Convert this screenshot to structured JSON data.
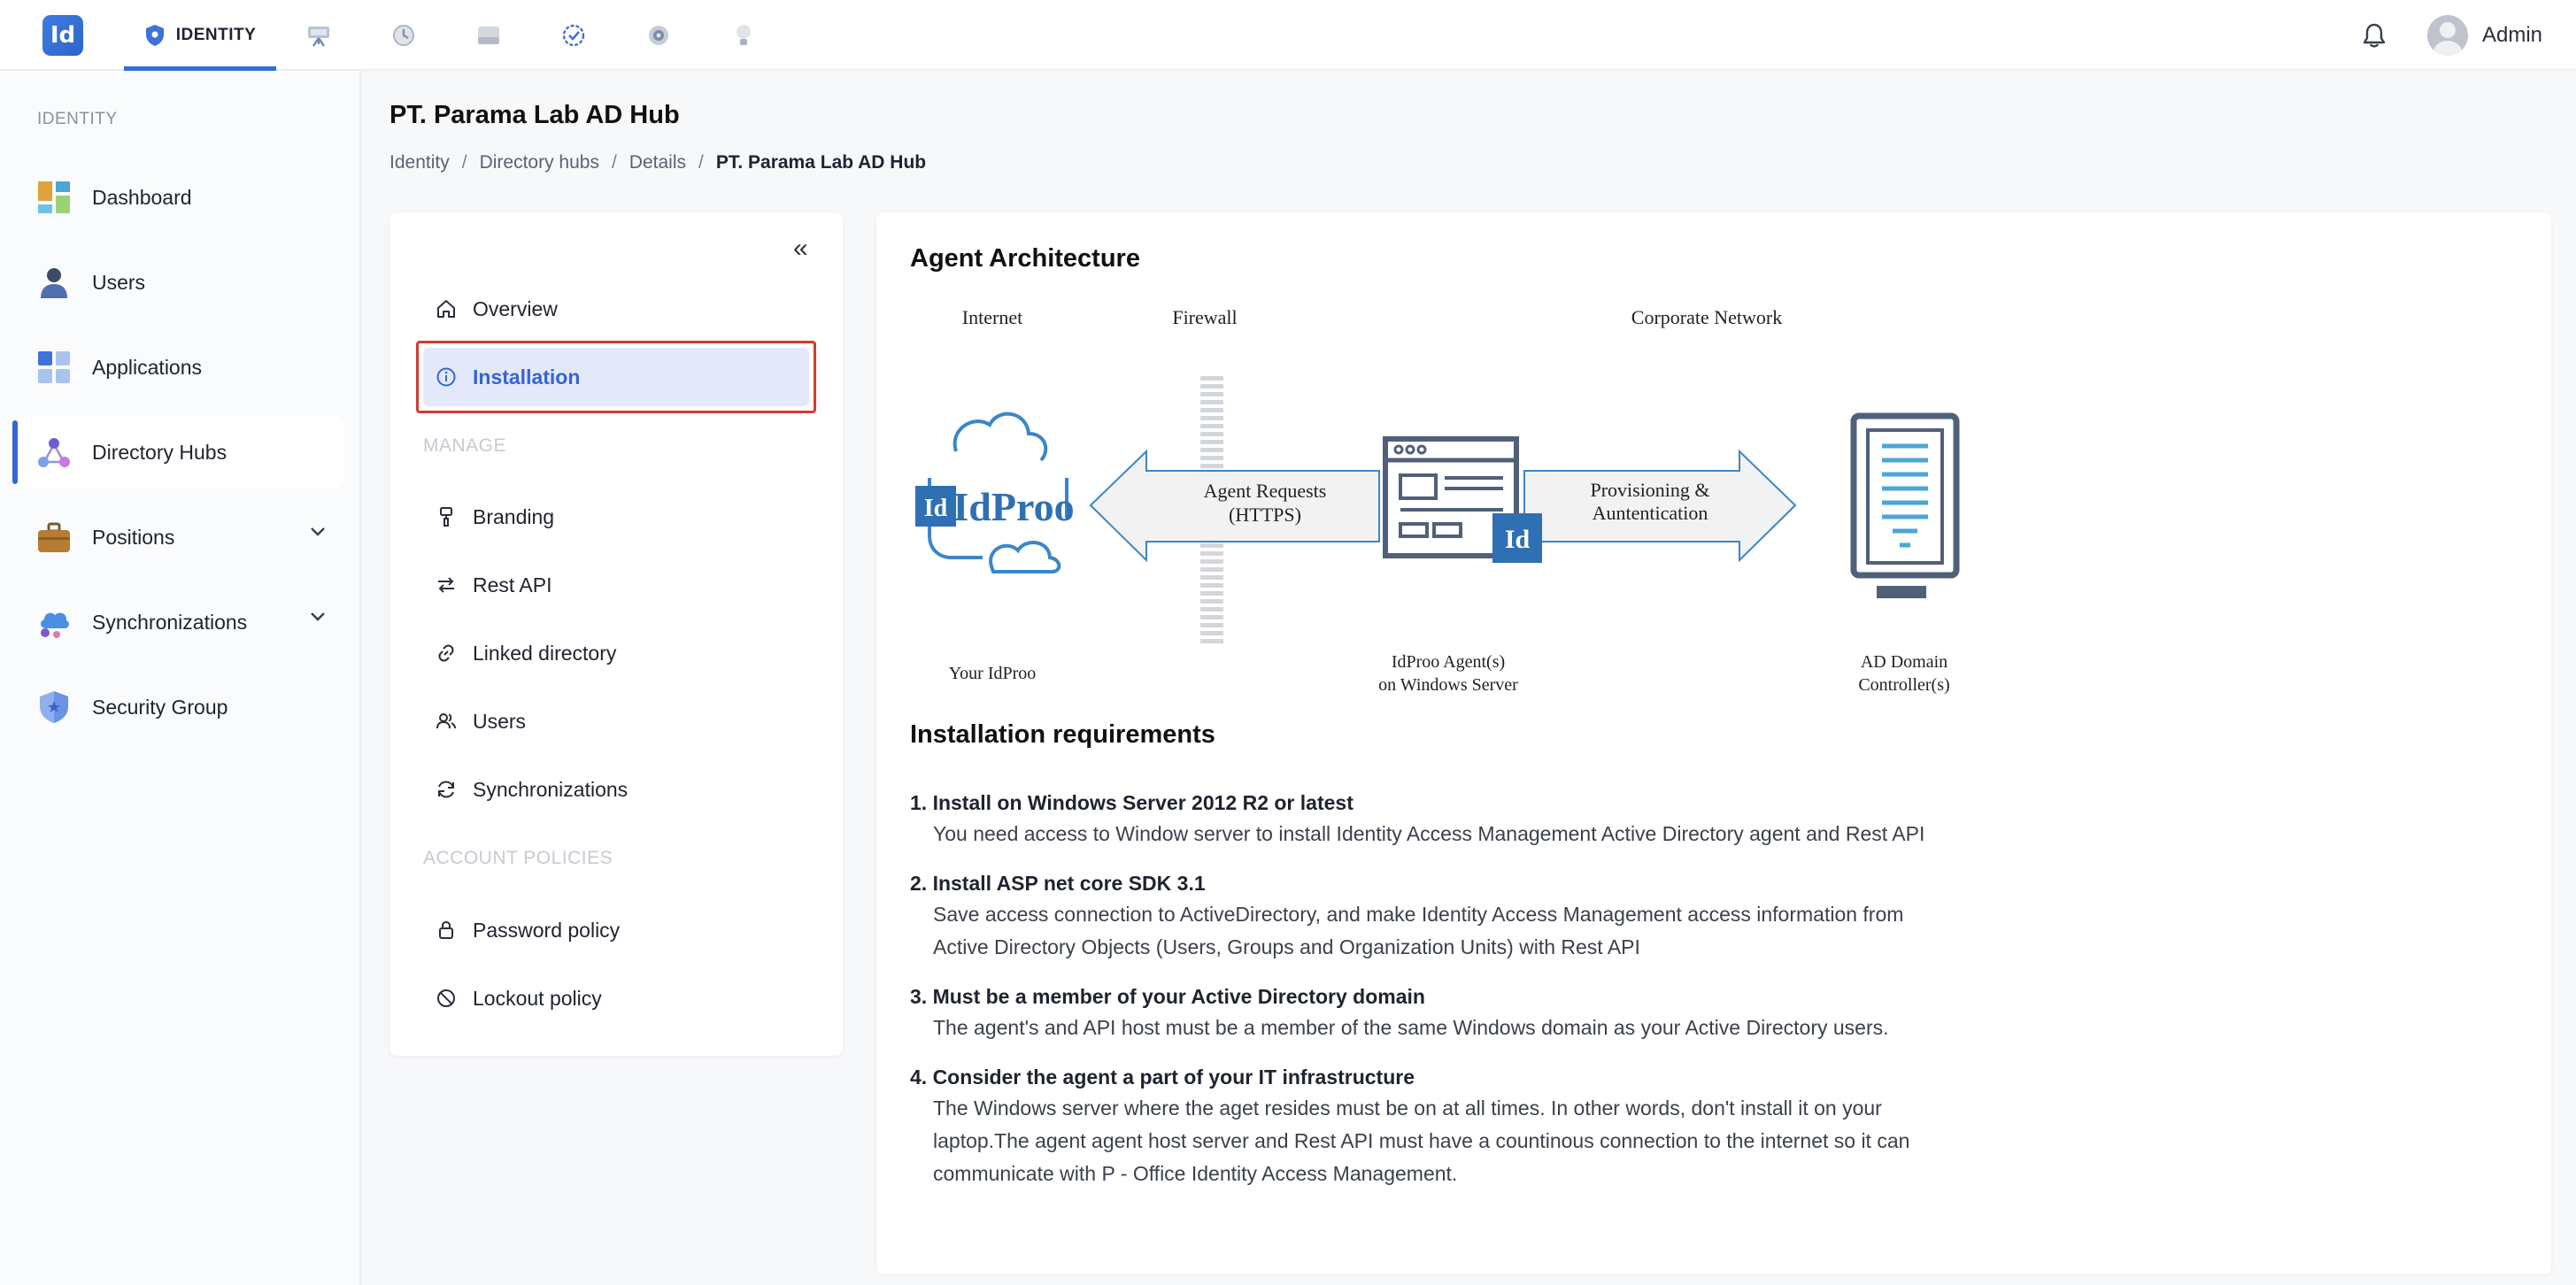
{
  "app": {
    "logo_text": "Id",
    "active_tab": "IDENTITY",
    "nav_icons": [
      "display-icon",
      "clock-icon",
      "drive-icon",
      "check-badge-icon",
      "gear-icon",
      "bulb-icon"
    ],
    "user_name": "Admin"
  },
  "sidebar": {
    "section": "IDENTITY",
    "items": [
      {
        "label": "Dashboard",
        "icon": "dashboard-icon"
      },
      {
        "label": "Users",
        "icon": "user-icon"
      },
      {
        "label": "Applications",
        "icon": "apps-icon"
      },
      {
        "label": "Directory Hubs",
        "icon": "hub-icon"
      },
      {
        "label": "Positions",
        "icon": "briefcase-icon"
      },
      {
        "label": "Synchronizations",
        "icon": "cloud-sync-icon"
      },
      {
        "label": "Security Group",
        "icon": "shield-icon"
      }
    ]
  },
  "page": {
    "title": "PT. Parama Lab AD Hub",
    "breadcrumb": [
      "Identity",
      "Directory hubs",
      "Details",
      "PT. Parama Lab AD Hub"
    ]
  },
  "subnav": {
    "collapse": "«",
    "top": [
      "Overview",
      "Installation"
    ],
    "manage_heading": "MANAGE",
    "manage": [
      "Branding",
      "Rest API",
      "Linked directory",
      "Users",
      "Synchronizations"
    ],
    "policies_heading": "ACCOUNT POLICIES",
    "policies": [
      "Password policy",
      "Lockout policy"
    ]
  },
  "architecture": {
    "heading": "Agent Architecture",
    "labels": {
      "internet": "Internet",
      "firewall": "Firewall",
      "corporate": "Corporate Network",
      "logo": "IdProo",
      "logo_badge": "Id",
      "agent_badge": "Id",
      "req_line1": "Agent  Requests",
      "req_line2": "(HTTPS)",
      "prov_line1": "Provisioning &",
      "prov_line2": "Auntentication",
      "your_idproo": "Your IdProo",
      "agent_line1": "IdProo Agent(s)",
      "agent_line2": "on Windows Server",
      "dc_line1": "AD Domain",
      "dc_line2": "Controller(s)"
    }
  },
  "requirements": {
    "heading": "Installation requirements",
    "items": [
      {
        "title": "1. Install on Windows Server 2012 R2 or latest",
        "desc": [
          "You need access to Window server to install Identity Access Management Active Directory agent and Rest API"
        ]
      },
      {
        "title": "2. Install ASP net core SDK 3.1",
        "desc": [
          "Save access connection to ActiveDirectory, and make Identity Access Management access information from",
          "Active Directory Objects (Users, Groups and Organization Units) with Rest API"
        ]
      },
      {
        "title": "3. Must be a member of your Active Directory domain",
        "desc": [
          "The agent's and API host must be a member of the same Windows domain as your Active Directory users."
        ]
      },
      {
        "title": "4. Consider the agent a part of your IT infrastructure",
        "desc": [
          "The Windows server where the aget resides must be on at all times. In other words, don't install it on your",
          "laptop.The agent agent host server and Rest API must have a countinous connection to the internet so it can",
          "communicate with P - Office Identity Access Management."
        ]
      }
    ]
  },
  "colors": {
    "accent": "#3566d6",
    "highlight": "#d33b2e",
    "diagram_blue": "#2f6fb4"
  }
}
